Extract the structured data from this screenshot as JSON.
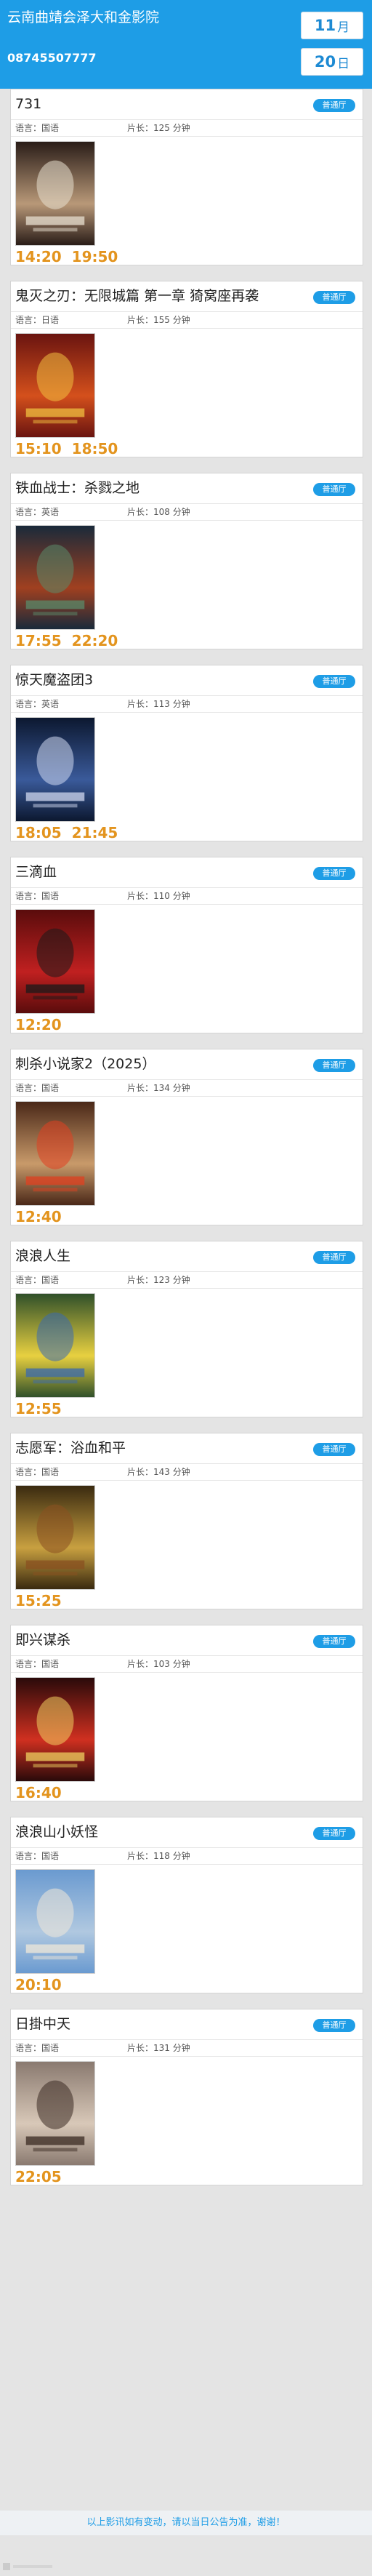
{
  "header": {
    "cinema_name": "云南曲靖会泽大和金影院",
    "phone": "08745507777",
    "month_num": "11",
    "month_unit": "月",
    "day_num": "20",
    "day_unit": "日"
  },
  "labels": {
    "language_prefix": "语言：",
    "duration_prefix": "片长：",
    "duration_unit": " 分钟"
  },
  "movies": [
    {
      "title": "731",
      "hall": "普通厅",
      "language": "国语",
      "duration": "125",
      "times": [
        "14:20",
        "19:50"
      ]
    },
    {
      "title": "鬼灭之刃：无限城篇 第一章 猗窝座再袭",
      "hall": "普通厅",
      "language": "日语",
      "duration": "155",
      "times": [
        "15:10",
        "18:50"
      ]
    },
    {
      "title": "铁血战士：杀戮之地",
      "hall": "普通厅",
      "language": "英语",
      "duration": "108",
      "times": [
        "17:55",
        "22:20"
      ]
    },
    {
      "title": "惊天魔盗团3",
      "hall": "普通厅",
      "language": "英语",
      "duration": "113",
      "times": [
        "18:05",
        "21:45"
      ]
    },
    {
      "title": "三滴血",
      "hall": "普通厅",
      "language": "国语",
      "duration": "110",
      "times": [
        "12:20"
      ]
    },
    {
      "title": "刺杀小说家2（2025）",
      "hall": "普通厅",
      "language": "国语",
      "duration": "134",
      "times": [
        "12:40"
      ]
    },
    {
      "title": "浪浪人生",
      "hall": "普通厅",
      "language": "国语",
      "duration": "123",
      "times": [
        "12:55"
      ]
    },
    {
      "title": "志愿军：浴血和平",
      "hall": "普通厅",
      "language": "国语",
      "duration": "143",
      "times": [
        "15:25"
      ]
    },
    {
      "title": "即兴谋杀",
      "hall": "普通厅",
      "language": "国语",
      "duration": "103",
      "times": [
        "16:40"
      ]
    },
    {
      "title": "浪浪山小妖怪",
      "hall": "普通厅",
      "language": "国语",
      "duration": "118",
      "times": [
        "20:10"
      ]
    },
    {
      "title": "日掛中天",
      "hall": "普通厅",
      "language": "国语",
      "duration": "131",
      "times": [
        "22:05"
      ]
    }
  ],
  "footer": {
    "notice": "以上影讯如有变动，请以当日公告为准，谢谢！"
  },
  "colors": {
    "accent": "#1e9de6",
    "time": "#e3941e"
  }
}
